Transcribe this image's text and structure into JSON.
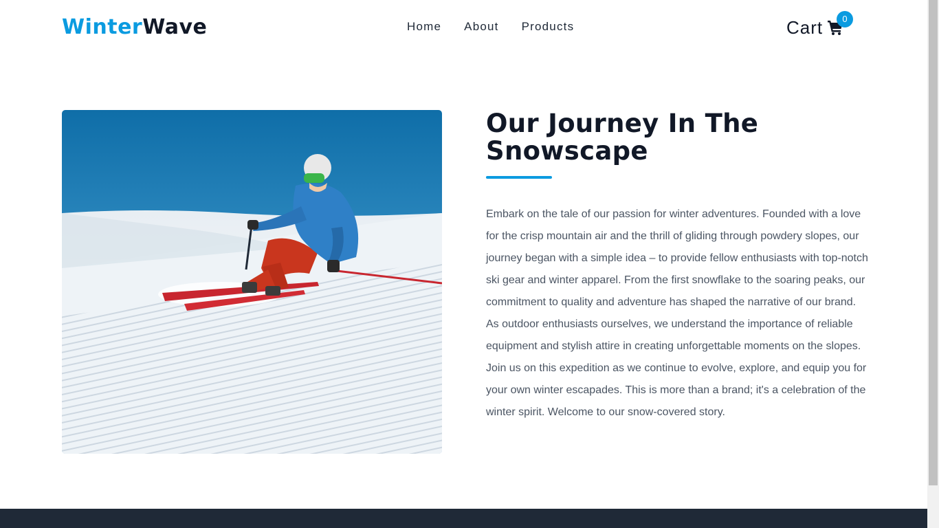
{
  "brand": {
    "part1": "Winter",
    "part2": "Wave"
  },
  "nav": {
    "items": [
      {
        "label": "Home"
      },
      {
        "label": "About"
      },
      {
        "label": "Products"
      }
    ]
  },
  "cart": {
    "label": "Cart",
    "count": "0",
    "icon": "shopping-cart-icon"
  },
  "about": {
    "title": "Our Journey In The Snowscape",
    "body": "Embark on the tale of our passion for winter adventures. Founded with a love for the crisp mountain air and the thrill of gliding through powdery slopes, our journey began with a simple idea – to provide fellow enthusiasts with top-notch ski gear and winter apparel. From the first snowflake to the soaring peaks, our commitment to quality and adventure has shaped the narrative of our brand. As outdoor enthusiasts ourselves, we understand the importance of reliable equipment and stylish attire in creating unforgettable moments on the slopes. Join us on this expedition as we continue to evolve, explore, and equip you for your own winter escapades. This is more than a brand; it's a celebration of the winter spirit. Welcome to our snow-covered story."
  },
  "colors": {
    "accent": "#0b9be0",
    "dark": "#111827",
    "footer": "#1f2937",
    "body_text": "#4b5563"
  }
}
